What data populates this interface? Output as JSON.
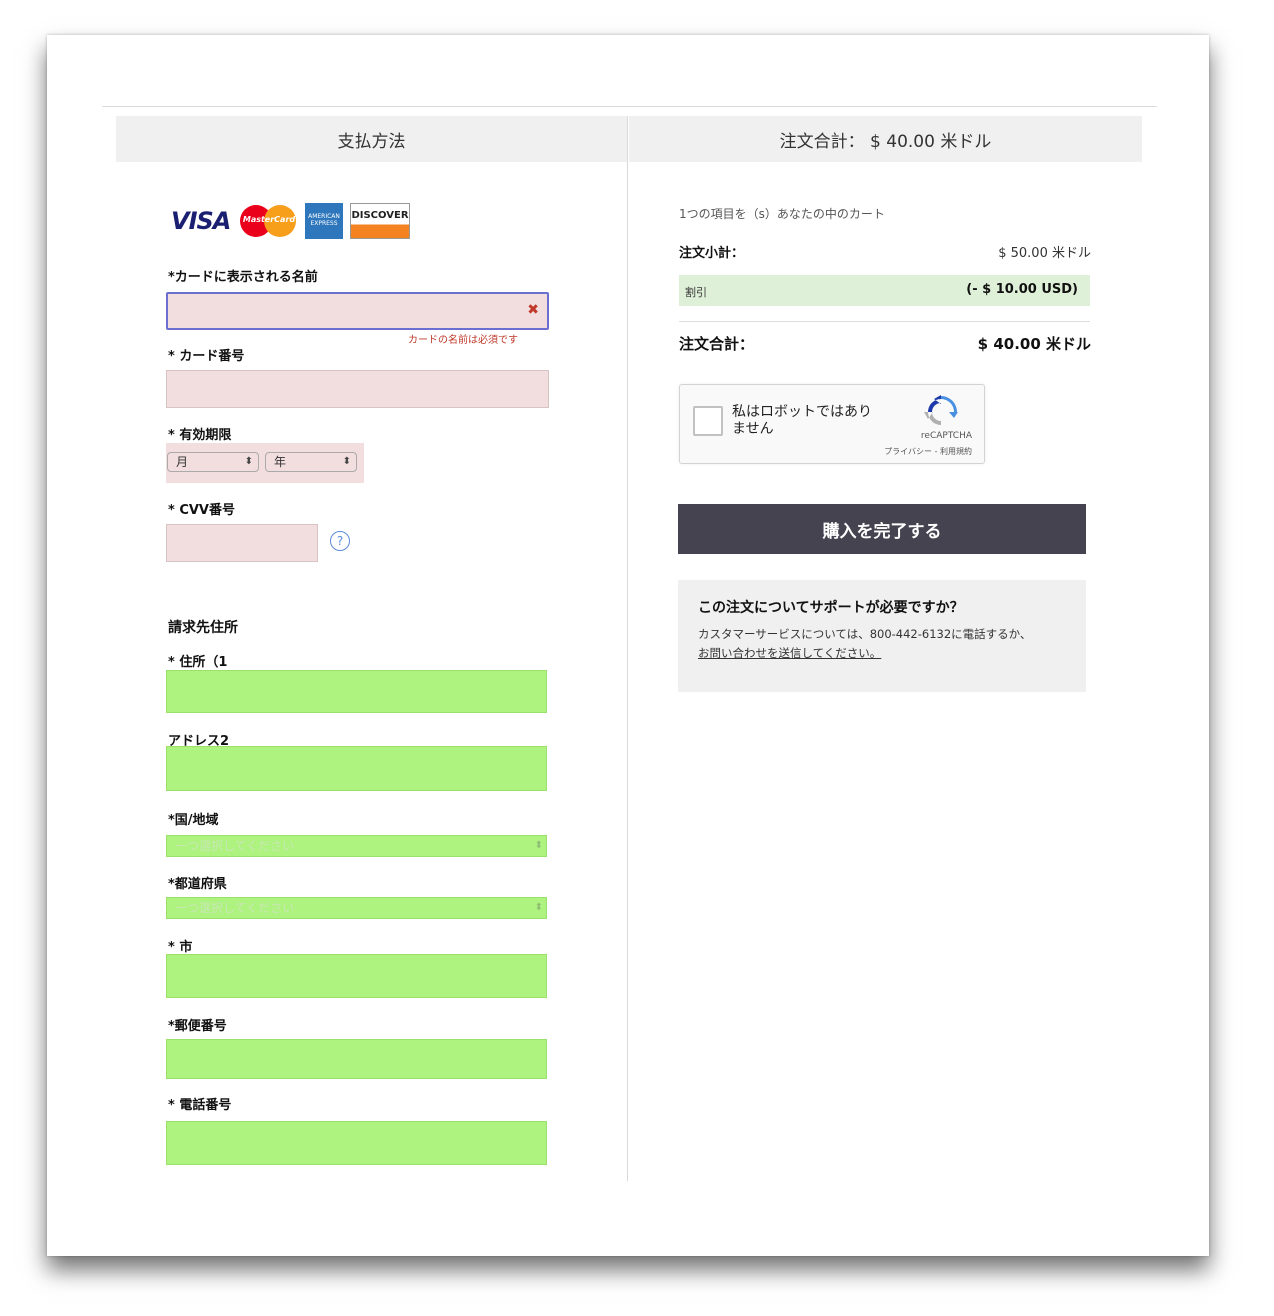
{
  "payment": {
    "header": "支払方法",
    "card_logos": {
      "visa": "VISA",
      "mastercard": "MasterCard",
      "amex": "AMERICAN EXPRESS",
      "discover": "DISCOVER"
    },
    "name_label": "*カードに表示される名前",
    "name_error": "カードの名前は必須です",
    "number_label": "* カード番号",
    "expiry_label": "* 有効期限",
    "month_value": "月",
    "year_value": "年",
    "cvv_label": "* CVV番号",
    "cvv_help": "?"
  },
  "billing": {
    "title": "請求先住所",
    "address1_label": "* 住所（1",
    "address2_label": "アドレス2",
    "country_label": "*国/地域",
    "country_placeholder": "一つ選択してください",
    "prefecture_label": "*都道府県",
    "prefecture_placeholder": "一つ選択してください",
    "city_label": "* 市",
    "postal_label": "*郵便番号",
    "phone_label": "* 電話番号"
  },
  "summary": {
    "header": "注文合計： $ 40.00 米ドル",
    "items_in_cart": "1つの項目を（s）あなたの中のカート",
    "subtotal_label": "注文小計：",
    "subtotal_value": "$ 50.00 米ドル",
    "discount_label": "割引",
    "discount_value": "(- $ 10.00 USD)",
    "total_label": "注文合計：",
    "total_value": "$ 40.00 米ドル"
  },
  "captcha": {
    "label": "私はロボットではありません",
    "brand": "reCAPTCHA",
    "links": "プライバシー - 利用規約"
  },
  "buy_button": "購入を完了する",
  "help": {
    "title": "この注文についてサポートが必要ですか？",
    "text": "カスタマーサービスについては、800-442-6132に電話するか、",
    "link": "お問い合わせを送信してください。"
  },
  "colors": {
    "error_fill": "#f2dede",
    "highlight_green": "#aef27f",
    "button_dark": "#45434f",
    "discount_green": "#dff0d8",
    "error_text": "#c0392b"
  }
}
